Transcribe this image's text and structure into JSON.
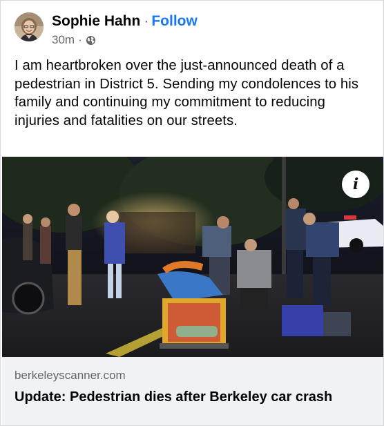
{
  "post": {
    "author": "Sophie Hahn",
    "separator": "·",
    "follow_label": "Follow",
    "timestamp": "30m",
    "meta_separator": "·",
    "audience_icon": "globe-icon",
    "text": "I am heartbroken over the just-announced death of a pedestrian in District 5. Sending my condolences to his family and continuing my commitment to reducing injuries and fatalities on our streets."
  },
  "media": {
    "info_icon": "info-icon",
    "info_glyph": "i"
  },
  "link_preview": {
    "domain": "berkeleyscanner.com",
    "title": "Update: Pedestrian dies after Berkeley car crash"
  },
  "colors": {
    "link_blue": "#1877f2",
    "secondary_text": "#65676b",
    "preview_bg": "#f0f2f5"
  }
}
